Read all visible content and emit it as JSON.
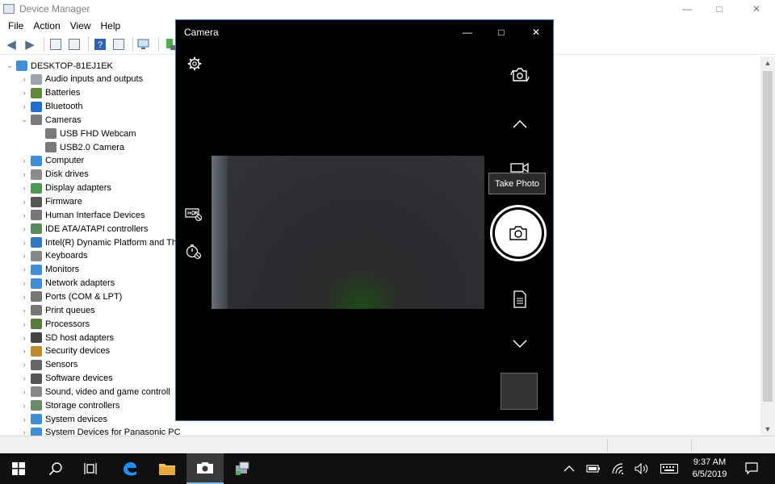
{
  "device_manager": {
    "title": "Device Manager",
    "window_controls": {
      "minimize": "—",
      "maximize": "□",
      "close": "✕"
    },
    "menu": [
      "File",
      "Action",
      "View",
      "Help"
    ],
    "tree": {
      "root": "DESKTOP-81EJ1EK",
      "items": [
        {
          "label": "Audio inputs and outputs",
          "expand": "›",
          "icon": "speaker-icon",
          "color": "#9aa4ae"
        },
        {
          "label": "Batteries",
          "expand": "›",
          "icon": "battery-icon",
          "color": "#5f8a3a"
        },
        {
          "label": "Bluetooth",
          "expand": "›",
          "icon": "bluetooth-icon",
          "color": "#1f6fd1"
        },
        {
          "label": "Cameras",
          "expand": "⌄",
          "icon": "webcam-icon",
          "color": "#7a7a7a"
        },
        {
          "label": "USB FHD Webcam",
          "expand": "",
          "icon": "webcam-icon",
          "color": "#7a7a7a",
          "child": true
        },
        {
          "label": "USB2.0 Camera",
          "expand": "",
          "icon": "webcam-icon",
          "color": "#7a7a7a",
          "child": true
        },
        {
          "label": "Computer",
          "expand": "›",
          "icon": "monitor-icon",
          "color": "#3f8fd6"
        },
        {
          "label": "Disk drives",
          "expand": "›",
          "icon": "disk-drive-icon",
          "color": "#8c8c8c"
        },
        {
          "label": "Display adapters",
          "expand": "›",
          "icon": "display-adapter-icon",
          "color": "#4c9a5a"
        },
        {
          "label": "Firmware",
          "expand": "›",
          "icon": "firmware-icon",
          "color": "#555555"
        },
        {
          "label": "Human Interface Devices",
          "expand": "›",
          "icon": "hid-icon",
          "color": "#777777"
        },
        {
          "label": "IDE ATA/ATAPI controllers",
          "expand": "›",
          "icon": "ide-controller-icon",
          "color": "#5a8a5a"
        },
        {
          "label": "Intel(R) Dynamic Platform and Th",
          "expand": "›",
          "icon": "platform-icon",
          "color": "#2f78c4"
        },
        {
          "label": "Keyboards",
          "expand": "›",
          "icon": "keyboard-icon",
          "color": "#888888"
        },
        {
          "label": "Monitors",
          "expand": "›",
          "icon": "monitor-icon",
          "color": "#3f8fd6"
        },
        {
          "label": "Network adapters",
          "expand": "›",
          "icon": "network-adapter-icon",
          "color": "#3f8fd6"
        },
        {
          "label": "Ports (COM & LPT)",
          "expand": "›",
          "icon": "port-icon",
          "color": "#777777"
        },
        {
          "label": "Print queues",
          "expand": "›",
          "icon": "printer-icon",
          "color": "#777777"
        },
        {
          "label": "Processors",
          "expand": "›",
          "icon": "processor-icon",
          "color": "#5a7a3a"
        },
        {
          "label": "SD host adapters",
          "expand": "›",
          "icon": "sd-card-icon",
          "color": "#444444"
        },
        {
          "label": "Security devices",
          "expand": "›",
          "icon": "security-device-icon",
          "color": "#c08a2a"
        },
        {
          "label": "Sensors",
          "expand": "›",
          "icon": "sensor-icon",
          "color": "#666666"
        },
        {
          "label": "Software devices",
          "expand": "›",
          "icon": "software-device-icon",
          "color": "#555555"
        },
        {
          "label": "Sound, video and game controll",
          "expand": "›",
          "icon": "sound-icon",
          "color": "#888888"
        },
        {
          "label": "Storage controllers",
          "expand": "›",
          "icon": "storage-controller-icon",
          "color": "#6a8a6a"
        },
        {
          "label": "System devices",
          "expand": "›",
          "icon": "system-device-icon",
          "color": "#3f8fd6"
        },
        {
          "label": "System Devices for Panasonic PC",
          "expand": "›",
          "icon": "system-device-icon",
          "color": "#3f8fd6"
        }
      ]
    }
  },
  "camera": {
    "title": "Camera",
    "window_controls": {
      "minimize": "—",
      "maximize": "□",
      "close": "✕"
    },
    "tooltip": "Take Photo"
  },
  "taskbar": {
    "clock_time": "9:37 AM",
    "clock_date": "6/5/2019"
  }
}
